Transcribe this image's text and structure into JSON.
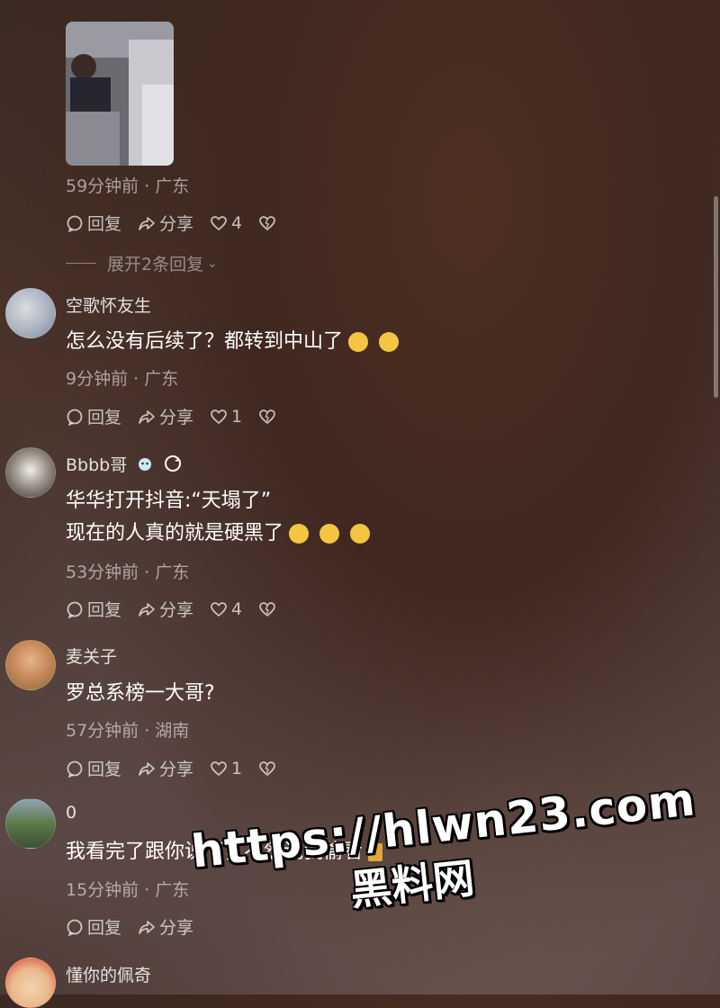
{
  "first_comment": {
    "time_location": "59分钟前 · 广东",
    "reply_label": "回复",
    "share_label": "分享",
    "like_count": "4",
    "expand_label": "展开2条回复"
  },
  "comments": [
    {
      "username": "空歌怀友生",
      "lines": [
        "怎么没有后续了？都转到中山了"
      ],
      "time_location": "9分钟前 · 广东",
      "reply_label": "回复",
      "share_label": "分享",
      "like_count": "1"
    },
    {
      "username": "Bbbb哥",
      "lines": [
        "华华打开抖音:“天塌了”",
        "现在的人真的就是硬黑了"
      ],
      "time_location": "53分钟前 · 广东",
      "reply_label": "回复",
      "share_label": "分享",
      "like_count": "4"
    },
    {
      "username": "麦关子",
      "lines": [
        "罗总系榜一大哥?"
      ],
      "time_location": "57分钟前 · 湖南",
      "reply_label": "回复",
      "share_label": "分享",
      "like_count": "1"
    },
    {
      "username": "0",
      "lines": [
        "我看完了跟你说下，不然说我偷看"
      ],
      "time_location": "15分钟前 · 广东",
      "reply_label": "回复",
      "share_label": "分享",
      "like_count": ""
    },
    {
      "username": "懂你的佩奇"
    }
  ],
  "watermark": {
    "url": "https://hlwn23.com",
    "text": "黑料网"
  }
}
